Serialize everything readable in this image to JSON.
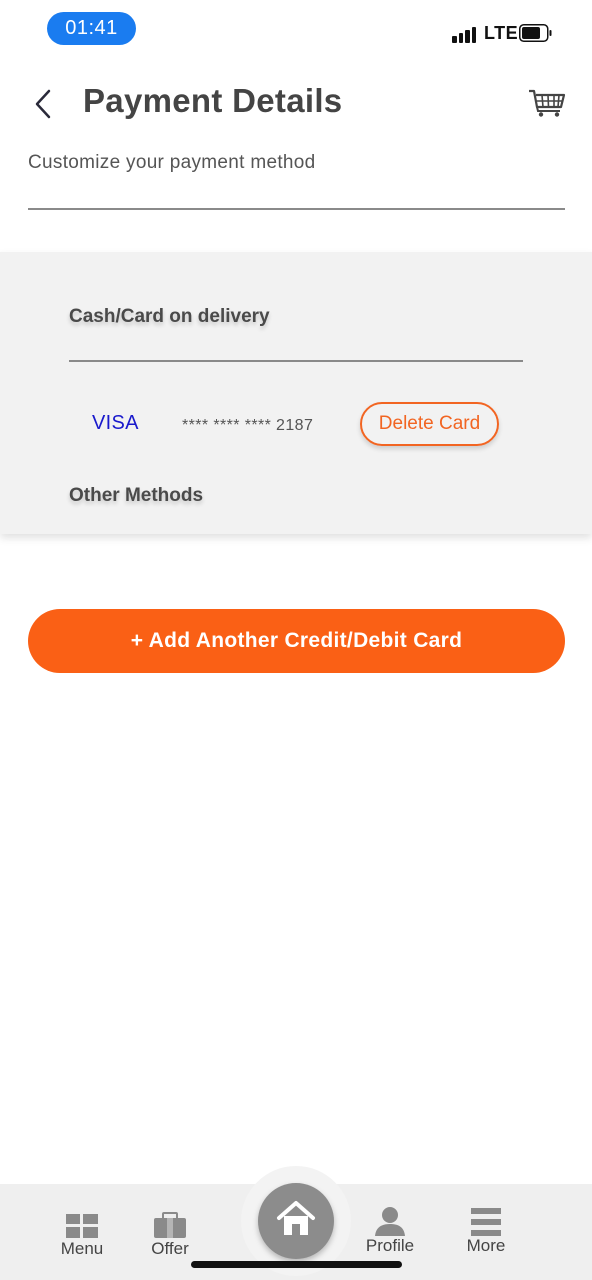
{
  "status_bar": {
    "time": "01:41",
    "network": "LTE"
  },
  "header": {
    "title": "Payment Details",
    "subtitle": "Customize your payment method"
  },
  "payment": {
    "cod_heading": "Cash/Card on delivery",
    "card": {
      "brand": "VISA",
      "number": "**** **** **** 2187",
      "delete_label": "Delete Card"
    },
    "other_heading": "Other Methods"
  },
  "add_card_label": "+ Add Another Credit/Debit Card",
  "bottom_nav": {
    "menu": "Menu",
    "offer": "Offer",
    "profile": "Profile",
    "more": "More"
  },
  "colors": {
    "accent": "#fa6015",
    "time_pill": "#1a7cf0",
    "visa_blue": "#1a1acc"
  }
}
